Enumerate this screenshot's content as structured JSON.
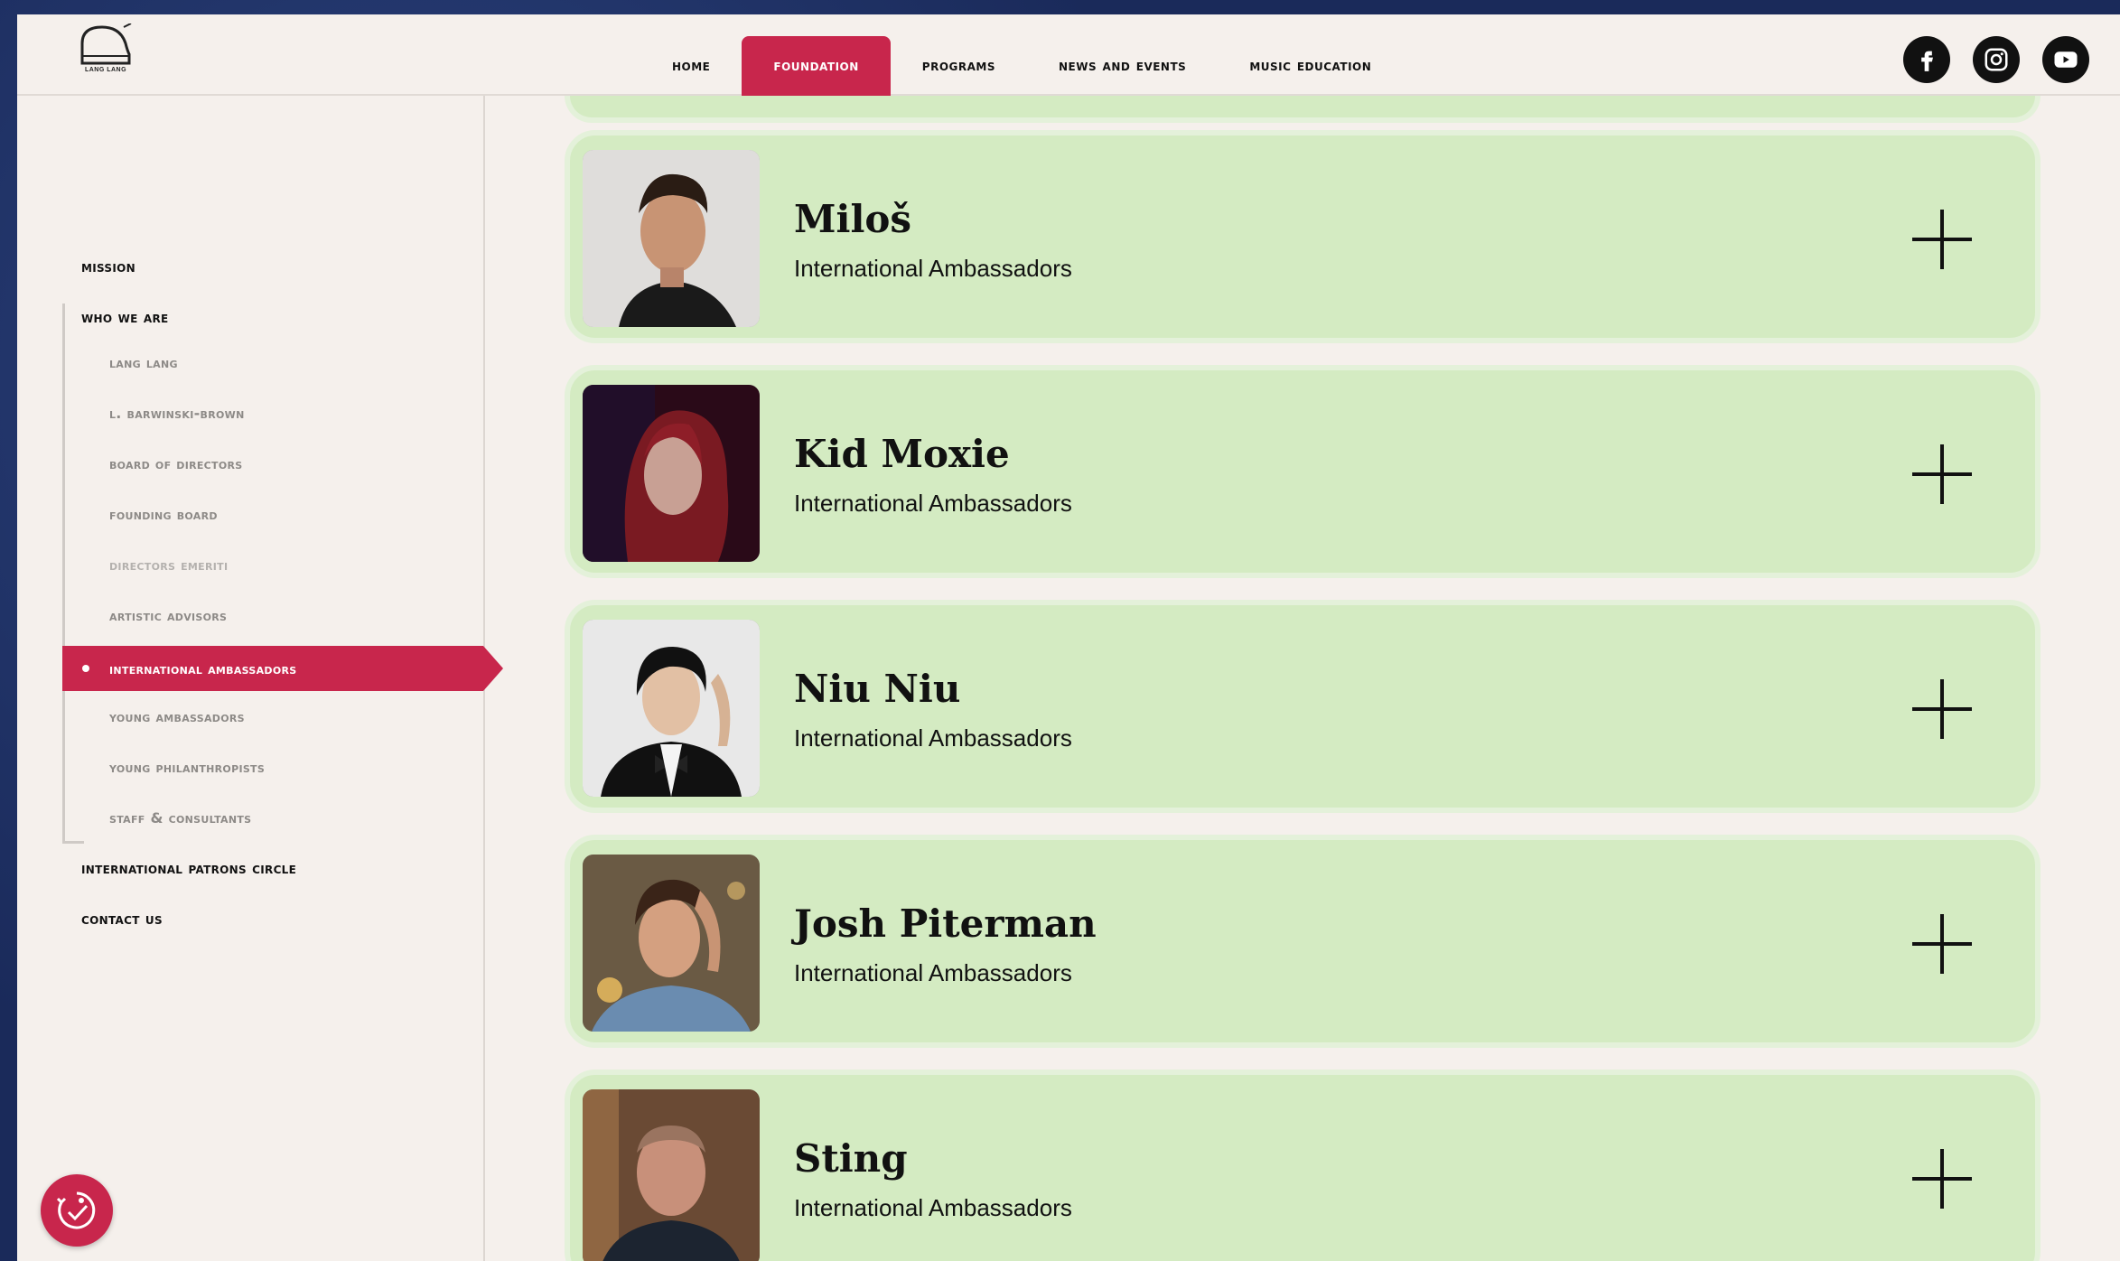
{
  "brand": {
    "logo_text": "LANG LANG"
  },
  "nav": {
    "items": [
      {
        "label": "Home",
        "active": false
      },
      {
        "label": "Foundation",
        "active": true
      },
      {
        "label": "Programs",
        "active": false
      },
      {
        "label": "News and Events",
        "active": false
      },
      {
        "label": "Music Education",
        "active": false
      }
    ]
  },
  "social": [
    "facebook-icon",
    "instagram-icon",
    "youtube-icon"
  ],
  "sidebar": {
    "mission": "Mission",
    "who_we_are": "Who We Are",
    "sub": [
      "Lang Lang",
      "L. Barwinski-Brown",
      "Board of Directors",
      "Founding Board",
      "Directors Emeriti",
      "Artistic Advisors",
      "International Ambassadors",
      "Young Ambassadors",
      "Young Philanthropists",
      "Staff & Consultants"
    ],
    "patrons": "International Patrons Circle",
    "contact": "Contact Us"
  },
  "cards": [
    {
      "name": "Miloš",
      "role": "International Ambassadors"
    },
    {
      "name": "Kid Moxie",
      "role": "International Ambassadors"
    },
    {
      "name": "Niu Niu",
      "role": "International Ambassadors"
    },
    {
      "name": "Josh Piterman",
      "role": "International Ambassadors"
    },
    {
      "name": "Sting",
      "role": "International Ambassadors"
    }
  ],
  "colors": {
    "accent": "#c8264c",
    "card_bg": "#d4ebc2",
    "page_bg": "#f5f0ec"
  }
}
